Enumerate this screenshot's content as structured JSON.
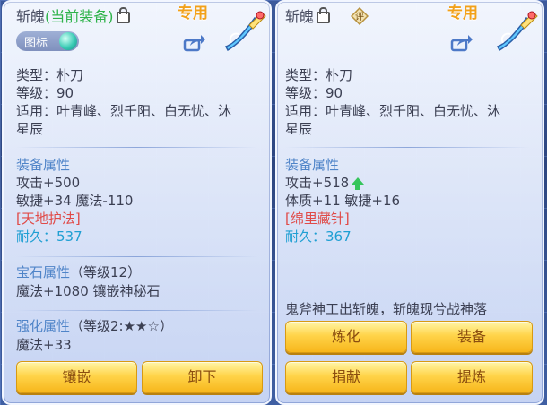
{
  "left_panel": {
    "title_name": "斩魄",
    "title_status": "(当前装备)",
    "exclusive": "专用",
    "badge_label": "图标",
    "type": "类型：朴刀",
    "level": "等级：90",
    "usable_line1": "适用：叶青峰、烈千阳、白无忧、沐",
    "usable_line2": "星辰",
    "attr_header": "装备属性",
    "attr_line1": "攻击+500",
    "attr_line2": "敏捷+34 魔法-110",
    "special": "[天地护法]",
    "durability_label": "耐久：",
    "durability_value": "537",
    "gem_header": "宝石属性",
    "gem_level": "（等级12）",
    "gem_line": "魔法+1080 镶嵌神秘石",
    "enhance_header": "强化属性",
    "enhance_level": "（等级2:★★☆）",
    "enhance_line": "魔法+33",
    "buttons": {
      "inlay": "镶嵌",
      "unequip": "卸下"
    }
  },
  "right_panel": {
    "title_name": "斩魄",
    "badge_text": "评",
    "exclusive": "专用",
    "type": "类型：朴刀",
    "level": "等级：90",
    "usable_line1": "适用：叶青峰、烈千阳、白无忧、沐",
    "usable_line2": "星辰",
    "attr_header": "装备属性",
    "attr_line1": "攻击+518",
    "attr_line2": "体质+11 敏捷+16",
    "special": "[绵里藏针]",
    "durability_label": "耐久：",
    "durability_value": "367",
    "description": "鬼斧神工出斩魄，斩魄现兮战神落",
    "buttons": {
      "refine": "炼化",
      "equip": "装备",
      "donate": "捐献",
      "extract": "提炼"
    }
  },
  "colors": {
    "accent_gold": "#f2a11a",
    "section_blue": "#4f84c8",
    "special_red": "#e04a48",
    "durability_blue": "#1f9fd3",
    "equipped_green": "#2fb34b",
    "button_text": "#8b4e10"
  },
  "icons": [
    "lock-icon",
    "weapon-sword-icon",
    "share-icon",
    "orb-icon",
    "upgrade-arrow-icon",
    "rating-diamond-icon"
  ]
}
